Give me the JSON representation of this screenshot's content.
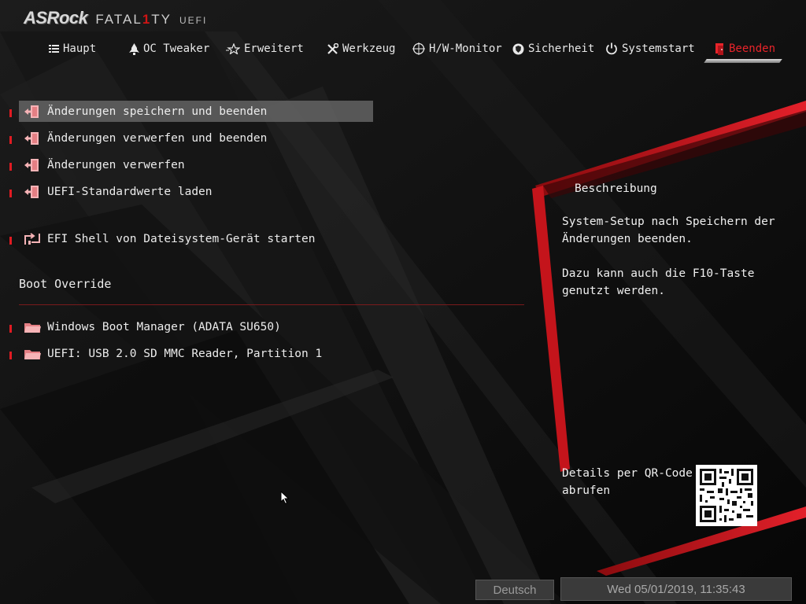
{
  "header": {
    "brand": "ASRock",
    "product_prefix": "FATAL",
    "product_highlight": "1",
    "product_suffix": "TY",
    "uefi": "UEFI"
  },
  "nav": [
    {
      "label": "Haupt",
      "icon": "list-icon",
      "active": false
    },
    {
      "label": "OC Tweaker",
      "icon": "rocket-icon",
      "active": false
    },
    {
      "label": "Erweitert",
      "icon": "star-icon",
      "active": false
    },
    {
      "label": "Werkzeug",
      "icon": "tools-icon",
      "active": false
    },
    {
      "label": "H/W-Monitor",
      "icon": "crosshair-icon",
      "active": false
    },
    {
      "label": "Sicherheit",
      "icon": "shield-icon",
      "active": false
    },
    {
      "label": "Systemstart",
      "icon": "power-icon",
      "active": false
    },
    {
      "label": "Beenden",
      "icon": "exit-door-icon",
      "active": true
    }
  ],
  "menu": {
    "items": [
      {
        "label": "Änderungen speichern und beenden",
        "icon": "exit-icon",
        "selected": true
      },
      {
        "label": "Änderungen verwerfen und beenden",
        "icon": "exit-icon",
        "selected": false
      },
      {
        "label": "Änderungen verwerfen",
        "icon": "exit-icon",
        "selected": false
      },
      {
        "label": "UEFI-Standardwerte laden",
        "icon": "exit-icon",
        "selected": false
      },
      {
        "label": "EFI Shell von Dateisystem-Gerät starten",
        "icon": "shell-icon",
        "selected": false
      }
    ],
    "boot_override_title": "Boot Override",
    "boot_items": [
      {
        "label": "Windows Boot Manager (ADATA SU650)",
        "icon": "folder-icon"
      },
      {
        "label": "UEFI: USB 2.0 SD MMC Reader, Partition 1",
        "icon": "folder-icon"
      }
    ]
  },
  "description": {
    "title": "Beschreibung",
    "text": "System-Setup nach Speichern der\nÄnderungen beenden.\n\nDazu kann auch die F10-Taste\ngenutzt werden.",
    "qr_label": "Details per QR-Code\nabrufen"
  },
  "footer": {
    "language": "Deutsch",
    "datetime": "Wed 05/01/2019, 11:35:43"
  },
  "colors": {
    "accent": "#e01b22",
    "background": "#0b0b0b",
    "selected": "#6e6e6e"
  }
}
